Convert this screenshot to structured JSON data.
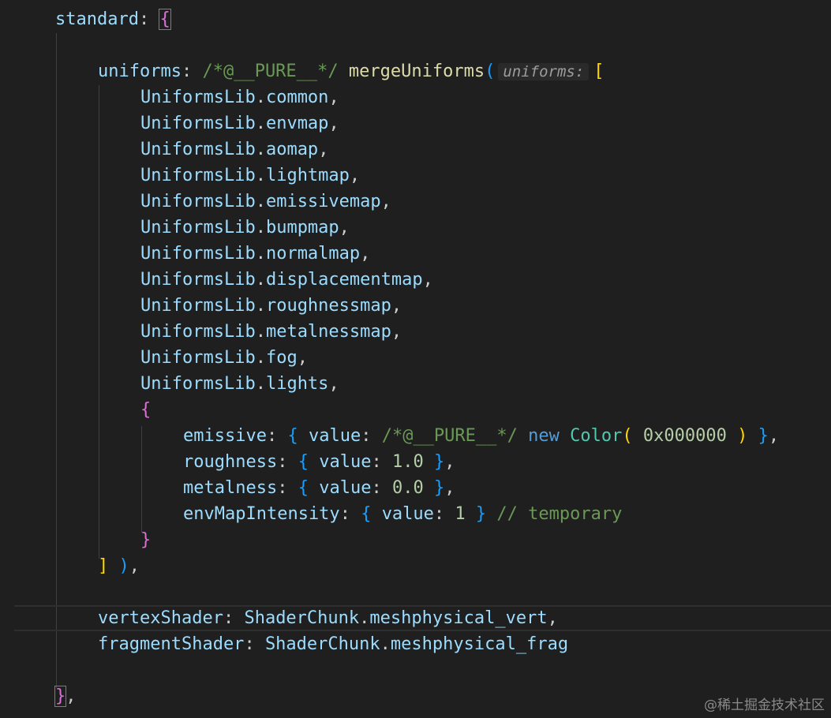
{
  "theme": {
    "background": "#1f1f1f",
    "property": "#9cdcfe",
    "function": "#dcdcaa",
    "class": "#4ec9b0",
    "keyword": "#569cd6",
    "number": "#b5cea8",
    "comment": "#6a9955",
    "punctuation": "#cccccc",
    "bracket_level_1": "#ffd700",
    "bracket_level_2": "#da70d6",
    "bracket_level_3": "#179fff"
  },
  "code": [
    {
      "indent": 1,
      "tokens": [
        {
          "t": "standard",
          "c": "prop"
        },
        {
          "t": ": ",
          "c": "punct"
        },
        {
          "t": "{",
          "c": "br-pink",
          "match": true
        }
      ]
    },
    {
      "indent": 0,
      "tokens": []
    },
    {
      "indent": 2,
      "tokens": [
        {
          "t": "uniforms",
          "c": "prop"
        },
        {
          "t": ": ",
          "c": "punct"
        },
        {
          "t": "/*@__PURE__*/",
          "c": "comment"
        },
        {
          "t": " ",
          "c": "punct"
        },
        {
          "t": "mergeUniforms",
          "c": "fn"
        },
        {
          "t": "(",
          "c": "br-blue"
        },
        {
          "t": "uniforms:",
          "c": "hint"
        },
        {
          "t": "[",
          "c": "br-yellow"
        }
      ]
    },
    {
      "indent": 3,
      "tokens": [
        {
          "t": "UniformsLib",
          "c": "prop"
        },
        {
          "t": ".",
          "c": "punct"
        },
        {
          "t": "common",
          "c": "prop"
        },
        {
          "t": ",",
          "c": "punct"
        }
      ]
    },
    {
      "indent": 3,
      "tokens": [
        {
          "t": "UniformsLib",
          "c": "prop"
        },
        {
          "t": ".",
          "c": "punct"
        },
        {
          "t": "envmap",
          "c": "prop"
        },
        {
          "t": ",",
          "c": "punct"
        }
      ]
    },
    {
      "indent": 3,
      "tokens": [
        {
          "t": "UniformsLib",
          "c": "prop"
        },
        {
          "t": ".",
          "c": "punct"
        },
        {
          "t": "aomap",
          "c": "prop"
        },
        {
          "t": ",",
          "c": "punct"
        }
      ]
    },
    {
      "indent": 3,
      "tokens": [
        {
          "t": "UniformsLib",
          "c": "prop"
        },
        {
          "t": ".",
          "c": "punct"
        },
        {
          "t": "lightmap",
          "c": "prop"
        },
        {
          "t": ",",
          "c": "punct"
        }
      ]
    },
    {
      "indent": 3,
      "tokens": [
        {
          "t": "UniformsLib",
          "c": "prop"
        },
        {
          "t": ".",
          "c": "punct"
        },
        {
          "t": "emissivemap",
          "c": "prop"
        },
        {
          "t": ",",
          "c": "punct"
        }
      ]
    },
    {
      "indent": 3,
      "tokens": [
        {
          "t": "UniformsLib",
          "c": "prop"
        },
        {
          "t": ".",
          "c": "punct"
        },
        {
          "t": "bumpmap",
          "c": "prop"
        },
        {
          "t": ",",
          "c": "punct"
        }
      ]
    },
    {
      "indent": 3,
      "tokens": [
        {
          "t": "UniformsLib",
          "c": "prop"
        },
        {
          "t": ".",
          "c": "punct"
        },
        {
          "t": "normalmap",
          "c": "prop"
        },
        {
          "t": ",",
          "c": "punct"
        }
      ]
    },
    {
      "indent": 3,
      "tokens": [
        {
          "t": "UniformsLib",
          "c": "prop"
        },
        {
          "t": ".",
          "c": "punct"
        },
        {
          "t": "displacementmap",
          "c": "prop"
        },
        {
          "t": ",",
          "c": "punct"
        }
      ]
    },
    {
      "indent": 3,
      "tokens": [
        {
          "t": "UniformsLib",
          "c": "prop"
        },
        {
          "t": ".",
          "c": "punct"
        },
        {
          "t": "roughnessmap",
          "c": "prop"
        },
        {
          "t": ",",
          "c": "punct"
        }
      ]
    },
    {
      "indent": 3,
      "tokens": [
        {
          "t": "UniformsLib",
          "c": "prop"
        },
        {
          "t": ".",
          "c": "punct"
        },
        {
          "t": "metalnessmap",
          "c": "prop"
        },
        {
          "t": ",",
          "c": "punct"
        }
      ]
    },
    {
      "indent": 3,
      "tokens": [
        {
          "t": "UniformsLib",
          "c": "prop"
        },
        {
          "t": ".",
          "c": "punct"
        },
        {
          "t": "fog",
          "c": "prop"
        },
        {
          "t": ",",
          "c": "punct"
        }
      ]
    },
    {
      "indent": 3,
      "tokens": [
        {
          "t": "UniformsLib",
          "c": "prop"
        },
        {
          "t": ".",
          "c": "punct"
        },
        {
          "t": "lights",
          "c": "prop"
        },
        {
          "t": ",",
          "c": "punct"
        }
      ]
    },
    {
      "indent": 3,
      "tokens": [
        {
          "t": "{",
          "c": "br-pink"
        }
      ]
    },
    {
      "indent": 4,
      "tokens": [
        {
          "t": "emissive",
          "c": "prop"
        },
        {
          "t": ": ",
          "c": "punct"
        },
        {
          "t": "{",
          "c": "br-blue"
        },
        {
          "t": " ",
          "c": "punct"
        },
        {
          "t": "value",
          "c": "prop"
        },
        {
          "t": ": ",
          "c": "punct"
        },
        {
          "t": "/*@__PURE__*/",
          "c": "comment"
        },
        {
          "t": " ",
          "c": "punct"
        },
        {
          "t": "new",
          "c": "kw"
        },
        {
          "t": " ",
          "c": "punct"
        },
        {
          "t": "Color",
          "c": "cls"
        },
        {
          "t": "(",
          "c": "br-yellow"
        },
        {
          "t": " ",
          "c": "punct"
        },
        {
          "t": "0x000000",
          "c": "num"
        },
        {
          "t": " ",
          "c": "punct"
        },
        {
          "t": ")",
          "c": "br-yellow"
        },
        {
          "t": " ",
          "c": "punct"
        },
        {
          "t": "}",
          "c": "br-blue"
        },
        {
          "t": ",",
          "c": "punct"
        }
      ]
    },
    {
      "indent": 4,
      "tokens": [
        {
          "t": "roughness",
          "c": "prop"
        },
        {
          "t": ": ",
          "c": "punct"
        },
        {
          "t": "{",
          "c": "br-blue"
        },
        {
          "t": " ",
          "c": "punct"
        },
        {
          "t": "value",
          "c": "prop"
        },
        {
          "t": ": ",
          "c": "punct"
        },
        {
          "t": "1.0",
          "c": "num"
        },
        {
          "t": " ",
          "c": "punct"
        },
        {
          "t": "}",
          "c": "br-blue"
        },
        {
          "t": ",",
          "c": "punct"
        }
      ]
    },
    {
      "indent": 4,
      "tokens": [
        {
          "t": "metalness",
          "c": "prop"
        },
        {
          "t": ": ",
          "c": "punct"
        },
        {
          "t": "{",
          "c": "br-blue"
        },
        {
          "t": " ",
          "c": "punct"
        },
        {
          "t": "value",
          "c": "prop"
        },
        {
          "t": ": ",
          "c": "punct"
        },
        {
          "t": "0.0",
          "c": "num"
        },
        {
          "t": " ",
          "c": "punct"
        },
        {
          "t": "}",
          "c": "br-blue"
        },
        {
          "t": ",",
          "c": "punct"
        }
      ]
    },
    {
      "indent": 4,
      "tokens": [
        {
          "t": "envMapIntensity",
          "c": "prop"
        },
        {
          "t": ": ",
          "c": "punct"
        },
        {
          "t": "{",
          "c": "br-blue"
        },
        {
          "t": " ",
          "c": "punct"
        },
        {
          "t": "value",
          "c": "prop"
        },
        {
          "t": ": ",
          "c": "punct"
        },
        {
          "t": "1",
          "c": "num"
        },
        {
          "t": " ",
          "c": "punct"
        },
        {
          "t": "}",
          "c": "br-blue"
        },
        {
          "t": " ",
          "c": "punct"
        },
        {
          "t": "// temporary",
          "c": "comment"
        }
      ]
    },
    {
      "indent": 3,
      "tokens": [
        {
          "t": "}",
          "c": "br-pink"
        }
      ]
    },
    {
      "indent": 2,
      "tokens": [
        {
          "t": "]",
          "c": "br-yellow"
        },
        {
          "t": " ",
          "c": "punct"
        },
        {
          "t": ")",
          "c": "br-blue"
        },
        {
          "t": ",",
          "c": "punct"
        }
      ]
    },
    {
      "indent": 0,
      "tokens": []
    },
    {
      "indent": 2,
      "current": true,
      "tokens": [
        {
          "t": "vertexShader",
          "c": "prop"
        },
        {
          "t": ": ",
          "c": "punct"
        },
        {
          "t": "ShaderChunk",
          "c": "prop"
        },
        {
          "t": ".",
          "c": "punct"
        },
        {
          "t": "meshphysical_vert",
          "c": "prop"
        },
        {
          "t": ",",
          "c": "punct"
        }
      ]
    },
    {
      "indent": 2,
      "tokens": [
        {
          "t": "fragmentShader",
          "c": "prop"
        },
        {
          "t": ": ",
          "c": "punct"
        },
        {
          "t": "ShaderChunk",
          "c": "prop"
        },
        {
          "t": ".",
          "c": "punct"
        },
        {
          "t": "meshphysical_frag",
          "c": "prop"
        }
      ]
    },
    {
      "indent": 0,
      "tokens": []
    },
    {
      "indent": 1,
      "tokens": [
        {
          "t": "}",
          "c": "br-pink",
          "match": true
        },
        {
          "t": ",",
          "c": "punct"
        }
      ]
    }
  ],
  "watermark": "@稀土掘金技术社区"
}
